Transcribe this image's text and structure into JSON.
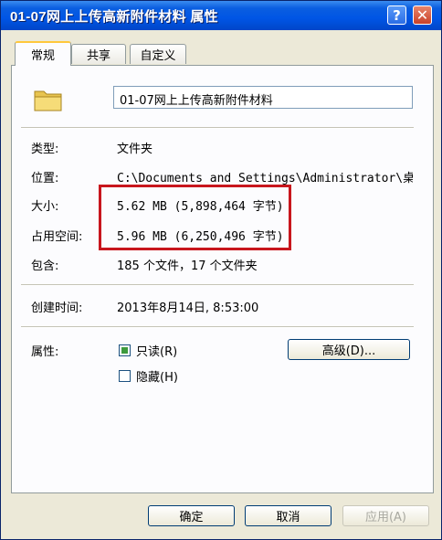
{
  "window": {
    "title": "01-07网上上传高新附件材料 属性",
    "help_glyph": "?",
    "close_glyph": "✕"
  },
  "tabs": [
    {
      "label": "常规"
    },
    {
      "label": "共享"
    },
    {
      "label": "自定义"
    }
  ],
  "general": {
    "name_value": "01-07网上上传高新附件材料",
    "type_label": "类型:",
    "type_value": "文件夹",
    "location_label": "位置:",
    "location_value": "C:\\Documents and Settings\\Administrator\\桌",
    "size_label": "大小:",
    "size_value": "5.62 MB (5,898,464 字节)",
    "disk_size_label": "占用空间:",
    "disk_size_value": "5.96 MB (6,250,496 字节)",
    "contains_label": "包含:",
    "contains_value": "185 个文件，17 个文件夹",
    "created_label": "创建时间:",
    "created_value": "2013年8月14日, 8:53:00",
    "attributes_label": "属性:",
    "readonly_label": "只读(R)",
    "readonly_state": "indeterminate",
    "hidden_label": "隐藏(H)",
    "hidden_state": "unchecked",
    "advanced_button": "高级(D)..."
  },
  "footer": {
    "ok": "确定",
    "cancel": "取消",
    "apply": "应用(A)"
  },
  "colors": {
    "title_bar": "#0055e5",
    "face": "#ece9d8",
    "highlight_box": "#c8161d",
    "tab_hot": "#ffc83c"
  }
}
